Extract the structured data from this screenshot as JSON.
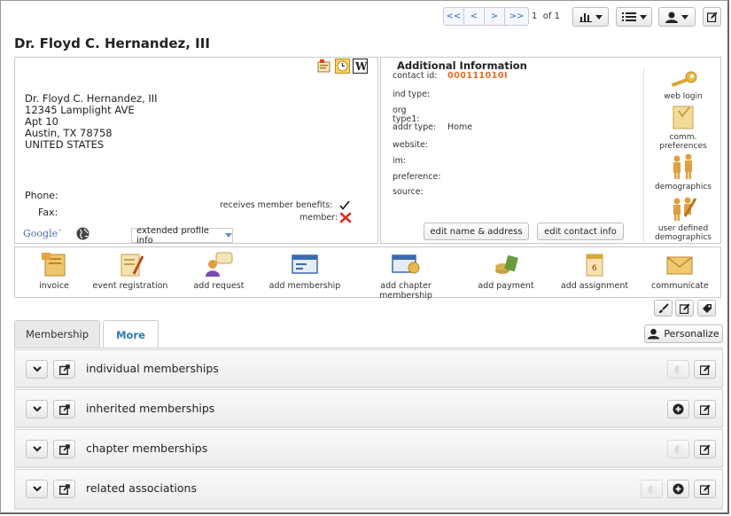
{
  "toolbar": {
    "pager": {
      "first": "<<",
      "prev": "<",
      "next": ">",
      "last": ">>"
    },
    "page_current": "1",
    "page_of": "of",
    "page_total": "1"
  },
  "title": "Dr. Floyd C. Hernandez, III",
  "address": {
    "name": "Dr. Floyd C. Hernandez, III",
    "line1": "12345 Lamplight AVE",
    "line2": "Apt 10",
    "city_state_zip": "Austin, TX 78758",
    "country": "UNITED STATES"
  },
  "phone_label": "Phone:",
  "fax_label": "Fax:",
  "google_label": "Google",
  "member_benefits_label": "receives member benefits:",
  "member_label": "member:",
  "extended_profile": "extended profile info",
  "additional": {
    "title": "Additional Information",
    "contact_id_label": "contact id:",
    "contact_id": "000111010I",
    "ind_type_label": "ind type:",
    "org_type_label": "org type1:",
    "addr_type_label": "addr type:",
    "addr_type_value": "Home",
    "website_label": "website:",
    "im_label": "im:",
    "preference_label": "preference:",
    "source_label": "source:",
    "edit_name_address": "edit name & address",
    "edit_contact_info": "edit contact info"
  },
  "side_links": {
    "web_login": "web login",
    "comm_preferences": "comm. preferences",
    "demographics": "demographics",
    "user_defined": "user defined demographics"
  },
  "actions": {
    "invoice": "invoice",
    "event_registration": "event registration",
    "add_request": "add request",
    "add_membership": "add membership",
    "add_chapter_membership": "add chapter membership",
    "add_payment": "add payment",
    "add_assignment": "add assignment",
    "communicate": "communicate"
  },
  "tabs": {
    "membership": "Membership",
    "more": "More"
  },
  "personalize": "Personalize",
  "sections": {
    "individual": "individual memberships",
    "inherited": "inherited memberships",
    "chapter": "chapter memberships",
    "related": "related associations"
  },
  "colors": {
    "accent": "#2a7ab8",
    "contact_id": "#e56a24",
    "member_x": "#d93020"
  }
}
